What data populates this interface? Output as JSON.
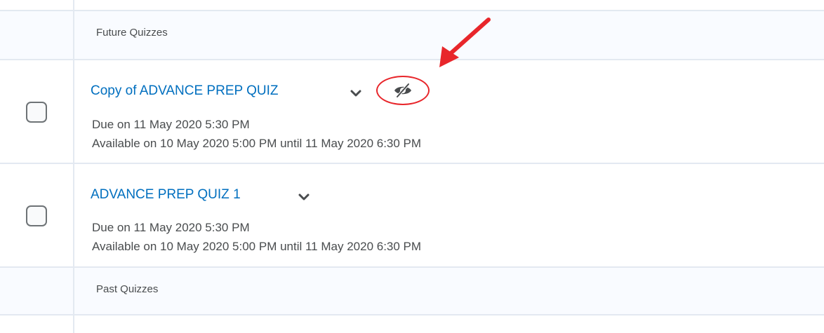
{
  "sections": {
    "future": {
      "title": "Future Quizzes"
    },
    "past": {
      "title": "Past Quizzes"
    }
  },
  "quizzes": [
    {
      "title": "Copy of ADVANCE PREP QUIZ",
      "due": "Due on 11 May 2020 5:30 PM",
      "availability": "Available on 10 May 2020 5:00 PM until 11 May 2020 6:30 PM",
      "hidden_icon": "eye-slash-icon"
    },
    {
      "title": "ADVANCE PREP QUIZ 1",
      "due": "Due on 11 May 2020 5:30 PM",
      "availability": "Available on 10 May 2020 5:00 PM until 11 May 2020 6:30 PM"
    }
  ],
  "colors": {
    "link": "#006fbf",
    "text": "#494c4e",
    "header_bg": "#f9fbff",
    "divider": "#e3e9f1",
    "annotation": "#e8262b"
  }
}
